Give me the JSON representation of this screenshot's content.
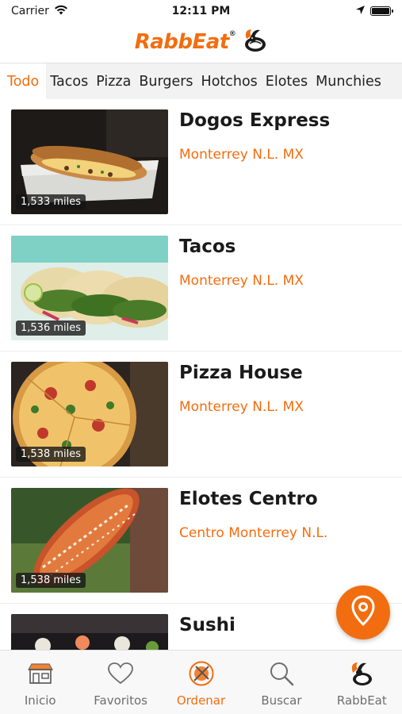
{
  "status_bar": {
    "carrier": "Carrier",
    "time": "12:11 PM"
  },
  "header": {
    "brand": "RabbEat",
    "reg_mark": "®"
  },
  "categories": [
    {
      "label": "Todo",
      "active": true
    },
    {
      "label": "Tacos",
      "active": false
    },
    {
      "label": "Pizza",
      "active": false
    },
    {
      "label": "Burgers",
      "active": false
    },
    {
      "label": "Hotchos",
      "active": false
    },
    {
      "label": "Elotes",
      "active": false
    },
    {
      "label": "Munchies",
      "active": false
    }
  ],
  "restaurants": [
    {
      "name": "Dogos Express",
      "location": "Monterrey N.L. MX",
      "distance": "1,533 miles",
      "image": "hot-dog-photo"
    },
    {
      "name": "Tacos",
      "location": "Monterrey N.L. MX",
      "distance": "1,536 miles",
      "image": "tacos-photo"
    },
    {
      "name": "Pizza House",
      "location": "Monterrey N.L. MX",
      "distance": "1,538 miles",
      "image": "pizza-photo"
    },
    {
      "name": "Elotes Centro",
      "location": "Centro Monterrey N.L.",
      "distance": "1,538 miles",
      "image": "elote-photo"
    },
    {
      "name": "Sushi",
      "location": "",
      "distance": "",
      "image": "sushi-photo"
    }
  ],
  "tabbar": [
    {
      "label": "Inicio",
      "icon": "storefront-icon",
      "active": false
    },
    {
      "label": "Favoritos",
      "icon": "heart-icon",
      "active": false
    },
    {
      "label": "Ordenar",
      "icon": "plate-icon",
      "active": true
    },
    {
      "label": "Buscar",
      "icon": "search-icon",
      "active": false
    },
    {
      "label": "RabbEat",
      "icon": "rabbit-logo-icon",
      "active": false
    }
  ],
  "colors": {
    "accent": "#f26d0f",
    "tab_background": "#f2f2f2",
    "tabbar_background": "#f8f8f8"
  },
  "fab": {
    "icon": "map-pin-icon"
  }
}
